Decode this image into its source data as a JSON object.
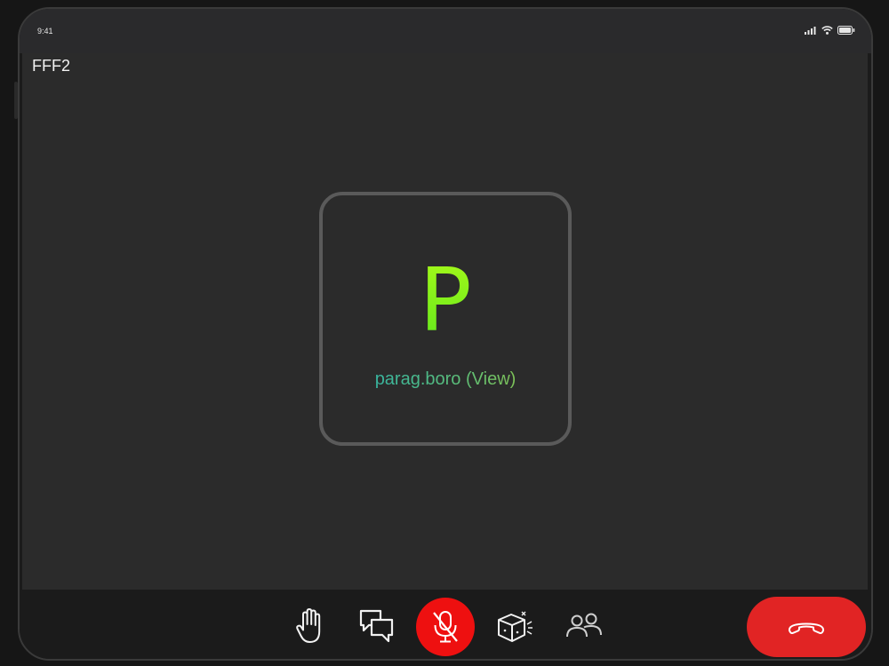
{
  "status_bar": {
    "time": "9:41",
    "icons": [
      "signal-icon",
      "wifi-icon",
      "battery-icon"
    ]
  },
  "meeting": {
    "room_name": "FFF2"
  },
  "participant": {
    "avatar_letter": "P",
    "display_name": "parag.boro (View)"
  },
  "toolbar": {
    "buttons": [
      {
        "icon": "raise-hand-icon"
      },
      {
        "icon": "chat-icon"
      },
      {
        "icon": "mic-off-icon",
        "state": "muted"
      },
      {
        "icon": "3d-view-icon"
      },
      {
        "icon": "participants-icon"
      },
      {
        "icon": "end-call-icon"
      }
    ]
  },
  "colors": {
    "stage_background": "#2b2b2b",
    "tile_border": "#5a5a5a",
    "avatar_gradient": [
      "#a4f81a",
      "#62e81c"
    ],
    "name_gradient": [
      "#22b1b9",
      "#9cc63a"
    ],
    "mic_muted": "#ee1010",
    "end_call": "#e12424"
  }
}
